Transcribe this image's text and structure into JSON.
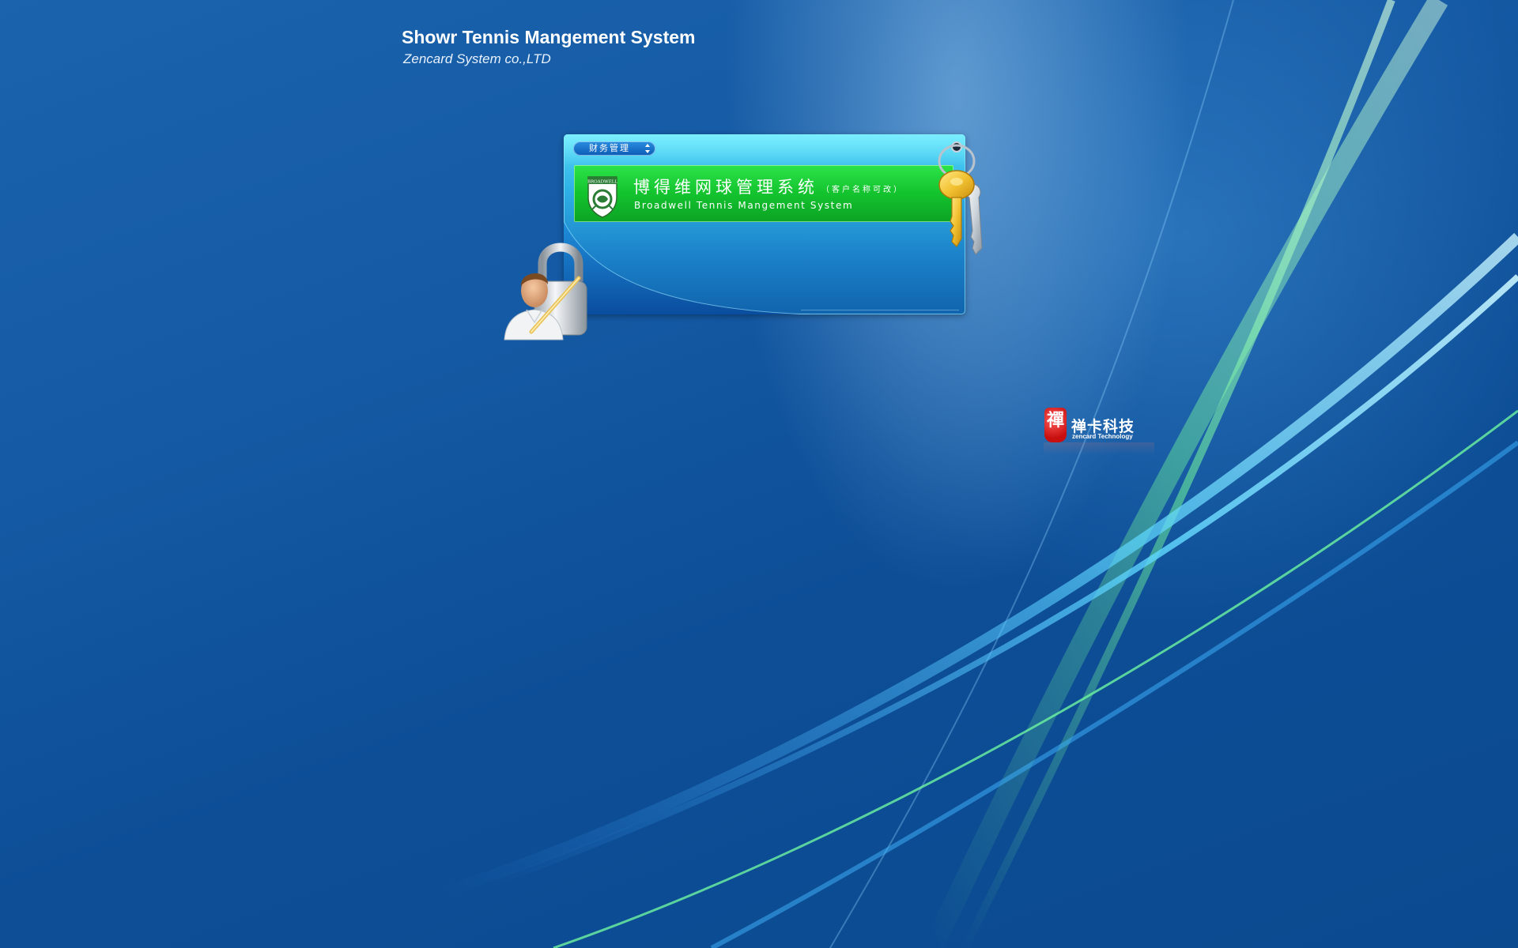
{
  "header": {
    "title": "Showr Tennis Mangement System",
    "subtitle": "Zencard System co.,LTD"
  },
  "login_panel": {
    "module_select": {
      "value": "财务管理"
    },
    "banner": {
      "title_cn": "博得维网球管理系统",
      "title_note": "（客户名称可改）",
      "title_en": "Broadwell Tennis Mangement System",
      "crest_text": "BROADWELL"
    }
  },
  "company_logo": {
    "seal_char": "禪",
    "name_cn": "禅卡科技",
    "name_en": "zencard Technology"
  },
  "icons": {
    "keys": "keys-icon",
    "user_lock": "user-lock-icon",
    "crest": "crest-icon",
    "select_arrows": "up-down-arrows-icon"
  },
  "colors": {
    "desktop_blue": "#1459a3",
    "banner_green": "#13c32e",
    "panel_cyan": "#2fb2e6",
    "seal_red": "#c80f0f",
    "key_gold": "#f2c232"
  }
}
